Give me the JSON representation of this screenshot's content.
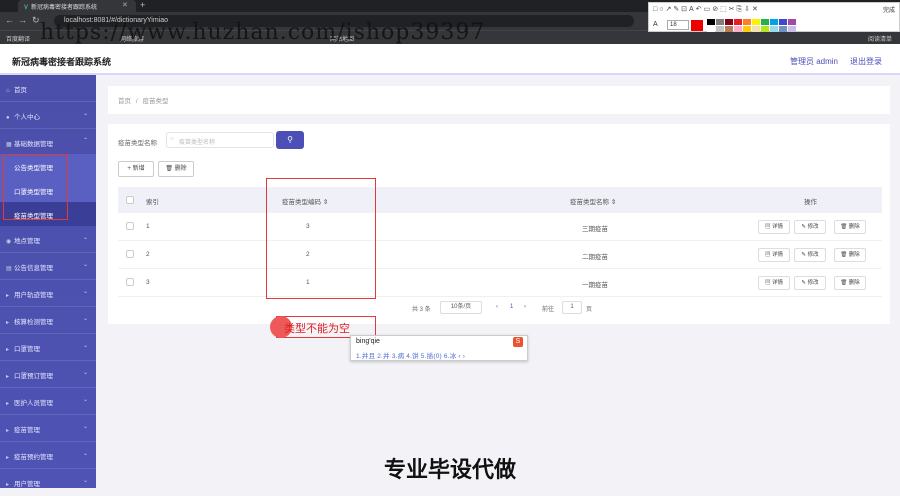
{
  "browser": {
    "tab_title": "新冠病毒密接者跟踪系统",
    "url": "localhost:8081/#/dictionaryYimiao",
    "bookmarks": [
      "百度翻译",
      "网络旅游",
      "网站地图",
      "阅读清单"
    ]
  },
  "watermark": "https://www.huzhan.com/ishop39397",
  "annotation_toolbar": {
    "done_label": "完成",
    "font_size": "18",
    "colors": [
      "#000000",
      "#7f7f7f",
      "#880015",
      "#ed1c24",
      "#ff7f27",
      "#fff200",
      "#22b14c",
      "#00a2e8",
      "#3f48cc",
      "#a349a4",
      "#ffffff",
      "#c3c3c3",
      "#b97a57",
      "#ffaec9",
      "#ffc90e",
      "#efe4b0",
      "#b5e61d",
      "#99d9ea",
      "#7092be",
      "#c8bfe7"
    ]
  },
  "header": {
    "title": "新冠病毒密接者跟踪系统",
    "admin": "管理员 admin",
    "logout": "退出登录"
  },
  "sidebar": {
    "items": [
      {
        "label": "首页",
        "icon": "home-icon"
      },
      {
        "label": "个人中心",
        "icon": "user-icon"
      },
      {
        "label": "基础数据管理",
        "icon": "grid-icon"
      },
      {
        "label": "地点管理",
        "icon": "location-icon"
      },
      {
        "label": "公告信息管理",
        "icon": "notice-icon"
      },
      {
        "label": "用户轨迹管理",
        "icon": "track-icon"
      },
      {
        "label": "核算检测管理",
        "icon": "test-icon"
      },
      {
        "label": "口罩管理",
        "icon": "mask-icon"
      },
      {
        "label": "口罩预订管理",
        "icon": "order-icon"
      },
      {
        "label": "医护人员管理",
        "icon": "doctor-icon"
      },
      {
        "label": "疫苗管理",
        "icon": "vaccine-icon"
      },
      {
        "label": "疫苗预约管理",
        "icon": "appointment-icon"
      },
      {
        "label": "用户管理",
        "icon": "users-icon"
      }
    ],
    "subitems": [
      "公告类型管理",
      "口罩类型管理",
      "疫苗类型管理"
    ]
  },
  "breadcrumb": {
    "home": "首页",
    "separator": "/",
    "current": "疫苗类型"
  },
  "search": {
    "label": "疫苗类型名称",
    "placeholder": "疫苗类型名称"
  },
  "actions": {
    "add": "+ 新增",
    "delete": "删除"
  },
  "table": {
    "headers": {
      "index": "索引",
      "code": "疫苗类型编码",
      "name": "疫苗类型名称",
      "ops": "操作"
    },
    "rows": [
      {
        "index": "1",
        "code": "3",
        "name": "三期疫苗"
      },
      {
        "index": "2",
        "code": "2",
        "name": "二期疫苗"
      },
      {
        "index": "3",
        "code": "1",
        "name": "一期疫苗"
      }
    ],
    "row_buttons": {
      "detail": "详情",
      "edit": "修改",
      "delete": "删除"
    }
  },
  "pagination": {
    "total": "共 3 条",
    "page_size": "10条/页",
    "current": "1",
    "goto_label": "前往",
    "goto_value": "1",
    "page_unit": "页"
  },
  "error_message": "类型不能为空",
  "ime": {
    "input": "bing'qie",
    "candidates": "1.并且  2.并  3.病  4.饼  5.插(0)  6.冰  ‹ ›"
  },
  "caption": "专业毕设代做"
}
